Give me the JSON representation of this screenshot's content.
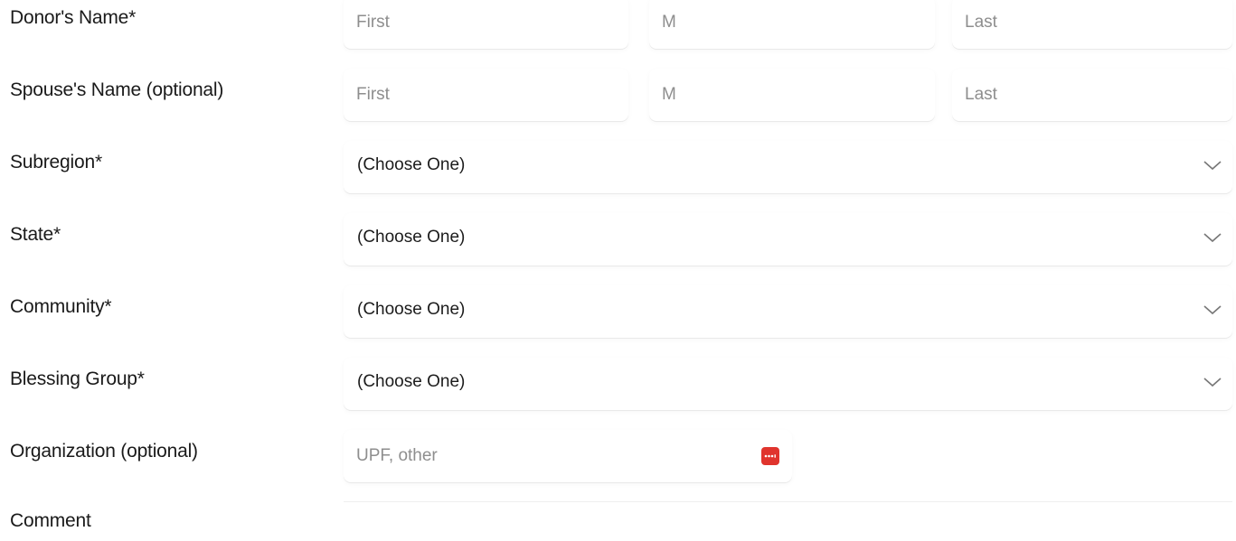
{
  "form": {
    "rows": {
      "donor": {
        "label": "Donor's Name*",
        "first_placeholder": "First",
        "middle_placeholder": "M",
        "last_placeholder": "Last"
      },
      "spouse": {
        "label": "Spouse's Name (optional)",
        "first_placeholder": "First",
        "middle_placeholder": "M",
        "last_placeholder": "Last"
      },
      "subregion": {
        "label": "Subregion*",
        "value": "(Choose One)"
      },
      "state": {
        "label": "State*",
        "value": "(Choose One)"
      },
      "community": {
        "label": "Community*",
        "value": "(Choose One)"
      },
      "blessing_group": {
        "label": "Blessing Group*",
        "value": "(Choose One)"
      },
      "organization": {
        "label": "Organization (optional)",
        "placeholder": "UPF, other"
      },
      "comment": {
        "label": "Comment"
      }
    }
  },
  "icons": {
    "select_arrow": "chevron-down-icon",
    "password_manager": "password-manager-icon"
  },
  "colors": {
    "password_manager_icon": "#e0342d",
    "chevron": "#777777",
    "placeholder": "#8e8e8e"
  }
}
